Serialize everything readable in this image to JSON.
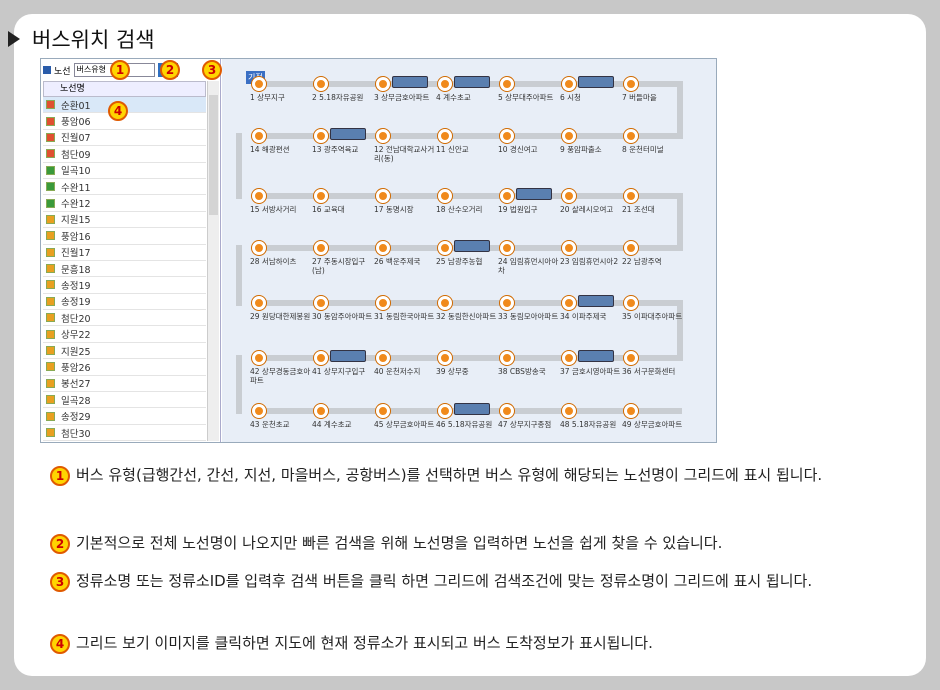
{
  "header": {
    "title": "버스위치 검색"
  },
  "toolbar": {
    "label": "노선",
    "select_value": "버스유형",
    "search_label": "검색"
  },
  "grid": {
    "column": "노선명",
    "rows": [
      {
        "name": "순환01",
        "color": "#e05030"
      },
      {
        "name": "풍암06",
        "color": "#e05030"
      },
      {
        "name": "진월07",
        "color": "#e05030"
      },
      {
        "name": "첨단09",
        "color": "#e05030"
      },
      {
        "name": "일곡10",
        "color": "#3a9a3a"
      },
      {
        "name": "수완11",
        "color": "#3a9a3a"
      },
      {
        "name": "수완12",
        "color": "#3a9a3a"
      },
      {
        "name": "지원15",
        "color": "#e8a020"
      },
      {
        "name": "풍암16",
        "color": "#e8a020"
      },
      {
        "name": "진월17",
        "color": "#e8a020"
      },
      {
        "name": "문흥18",
        "color": "#e8a020"
      },
      {
        "name": "송정19",
        "color": "#e8a020"
      },
      {
        "name": "송정19",
        "color": "#e8a020"
      },
      {
        "name": "첨단20",
        "color": "#e8a020"
      },
      {
        "name": "상무22",
        "color": "#e8a020"
      },
      {
        "name": "지원25",
        "color": "#e8a020"
      },
      {
        "name": "풍암26",
        "color": "#e8a020"
      },
      {
        "name": "봉선27",
        "color": "#e8a020"
      },
      {
        "name": "일곡28",
        "color": "#e8a020"
      },
      {
        "name": "송정29",
        "color": "#e8a020"
      },
      {
        "name": "첨단30",
        "color": "#e8a020"
      }
    ]
  },
  "map": {
    "start_label": "기점",
    "stops": [
      "1 상무지구",
      "2 5.18자유공원",
      "3 상무금호아파트",
      "4 계수초교",
      "5 상무대주아파트",
      "6 시청",
      "7 버들마을",
      "8 운천터미널",
      "9 풍암파출소",
      "10 경신여고",
      "11 신안교",
      "12 전남대학교사거리(동)",
      "13 광주역육교",
      "14 해광편션",
      "15 서방사거리",
      "16 교육대",
      "17 동명시장",
      "18 산수오거리",
      "19 법원입구",
      "20 살레시오여고",
      "21 조선대",
      "22 남광주역",
      "23 임림휴먼시아2",
      "24 임림휴먼시아아차",
      "25 남광주농협",
      "26 백운주제국",
      "27 주동시장입구(남)",
      "28 서남하이츠",
      "29 원당대한제봉원",
      "30 동암주아아파트",
      "31 동림한국아파트",
      "32 동림한신아파트",
      "33 동림모아아파트",
      "34 이파주제국",
      "35 이파대주아파트",
      "36 서구문화센터",
      "37 금호시영아파트",
      "38 CBS방송국",
      "39 상무중",
      "40 운천저수지",
      "41 상무지구입구",
      "42 상무경동금호아파트",
      "43 운천초교",
      "44 계수초교",
      "45 상무금호아파트",
      "46 5.18자유공원",
      "47 상무지구종점",
      "48 5.18자유공원",
      "49 상무금호아파트"
    ]
  },
  "markers": [
    "1",
    "2",
    "3",
    "4"
  ],
  "descriptions": [
    {
      "num": "1",
      "text": "버스 유형(급행간선, 간선, 지선, 마을버스, 공항버스)를 선택하면 버스 유형에 해당되는 노선명이 그리드에 표시 됩니다."
    },
    {
      "num": "2",
      "text": "기본적으로 전체 노선명이 나오지만 빠른 검색을 위해 노선명을 입력하면 노선을 쉽게 찾을 수 있습니다."
    },
    {
      "num": "3",
      "text": "정류소명 또는 정류소ID를 입력후 검색 버튼을 클릭 하면 그리드에 검색조건에 맞는 정류소명이 그리드에 표시 됩니다."
    },
    {
      "num": "4",
      "text": "그리드 보기 이미지를 클릭하면 지도에 현재 정류소가 표시되고 버스 도착정보가 표시됩니다."
    }
  ]
}
